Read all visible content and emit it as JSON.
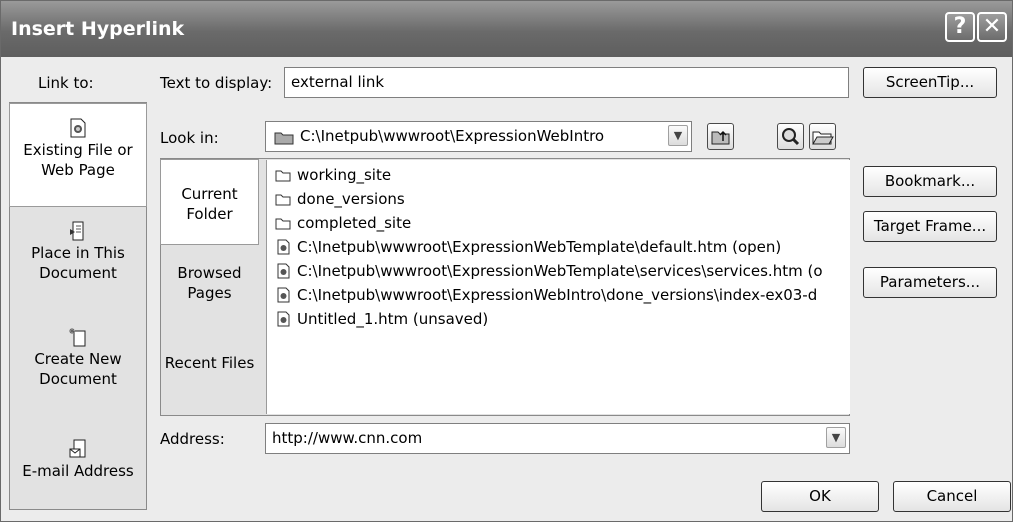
{
  "dialog": {
    "title": "Insert Hyperlink",
    "help_glyph": "?",
    "close_glyph": "✕"
  },
  "labels": {
    "link_to": "Link to:",
    "text_to_display": "Text to display:",
    "look_in": "Look in:",
    "address": "Address:"
  },
  "text_to_display_value": "external link",
  "look_in_value": "C:\\Inetpub\\wwwroot\\ExpressionWebIntro",
  "address_value": "http://www.cnn.com",
  "link_to_items": [
    {
      "label": "Existing File or Web Page",
      "icon": "existing-file-icon",
      "selected": true
    },
    {
      "label": "Place in This Document",
      "icon": "place-in-document-icon"
    },
    {
      "label": "Create New Document",
      "icon": "new-document-icon"
    },
    {
      "label": "E-mail Address",
      "icon": "email-address-icon"
    }
  ],
  "tabs": [
    {
      "label": "Current Folder",
      "selected": true
    },
    {
      "label": "Browsed Pages"
    },
    {
      "label": "Recent Files"
    }
  ],
  "files": [
    {
      "name": "working_site",
      "type": "folder"
    },
    {
      "name": "done_versions",
      "type": "folder"
    },
    {
      "name": "completed_site",
      "type": "folder"
    },
    {
      "name": "C:\\Inetpub\\wwwroot\\ExpressionWebTemplate\\default.htm (open)",
      "type": "page"
    },
    {
      "name": "C:\\Inetpub\\wwwroot\\ExpressionWebTemplate\\services\\services.htm (o",
      "type": "page"
    },
    {
      "name": "C:\\Inetpub\\wwwroot\\ExpressionWebIntro\\done_versions\\index-ex03-d",
      "type": "page"
    },
    {
      "name": "Untitled_1.htm (unsaved)",
      "type": "page"
    }
  ],
  "buttons": {
    "screentip": "ScreenTip...",
    "bookmark": "Bookmark...",
    "target_frame": "Target Frame...",
    "parameters": "Parameters...",
    "ok": "OK",
    "cancel": "Cancel"
  },
  "toolbar_icons": [
    "up-folder-icon",
    "browse-web-icon",
    "browse-file-icon"
  ],
  "colors": {
    "titlebar": "#6a6a6a",
    "dialog_bg": "#ececec",
    "selected_item_bg": "#ffffff"
  }
}
